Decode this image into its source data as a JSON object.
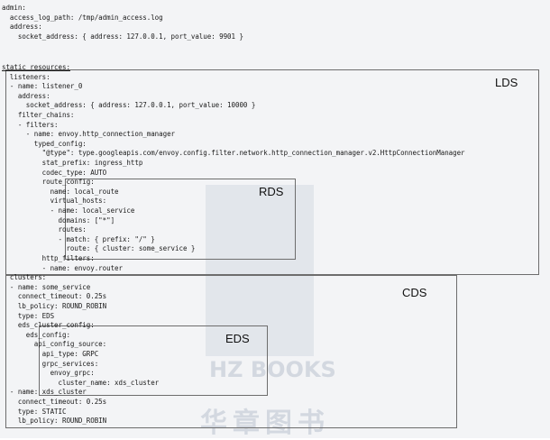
{
  "code_lines": [
    "admin:",
    "  access_log_path: /tmp/admin_access.log",
    "  address:",
    "    socket_address: { address: 127.0.0.1, port_value: 9901 }",
    "",
    "static_resources:",
    "  listeners:",
    "  - name: listener_0",
    "    address:",
    "      socket_address: { address: 127.0.0.1, port_value: 10000 }",
    "    filter_chains:",
    "    - filters:",
    "      - name: envoy.http_connection_manager",
    "        typed_config:",
    "          \"@type\": type.googleapis.com/envoy.config.filter.network.http_connection_manager.v2.HttpConnectionManager",
    "          stat_prefix: ingress_http",
    "          codec_type: AUTO",
    "          route_config:",
    "            name: local_route",
    "            virtual_hosts:",
    "            - name: local_service",
    "              domains: [\"*\"]",
    "              routes:",
    "              - match: { prefix: \"/\" }",
    "                route: { cluster: some_service }",
    "          http_filters:",
    "          - name: envoy.router",
    "  clusters:",
    "  - name: some_service",
    "    connect_timeout: 0.25s",
    "    lb_policy: ROUND_ROBIN",
    "    type: EDS",
    "    eds_cluster_config:",
    "      eds_config:",
    "        api_config_source:",
    "          api_type: GRPC",
    "          grpc_services:",
    "            envoy_grpc:",
    "              cluster_name: xds_cluster",
    "  - name: xds_cluster",
    "    connect_timeout: 0.25s",
    "    type: STATIC",
    "    lb_policy: ROUND_ROBIN"
  ],
  "boxes": {
    "lds": "LDS",
    "rds": "RDS",
    "cds": "CDS",
    "eds": "EDS"
  },
  "watermark": {
    "latin": "HZ BOOKS",
    "cjk": "华章图书"
  }
}
